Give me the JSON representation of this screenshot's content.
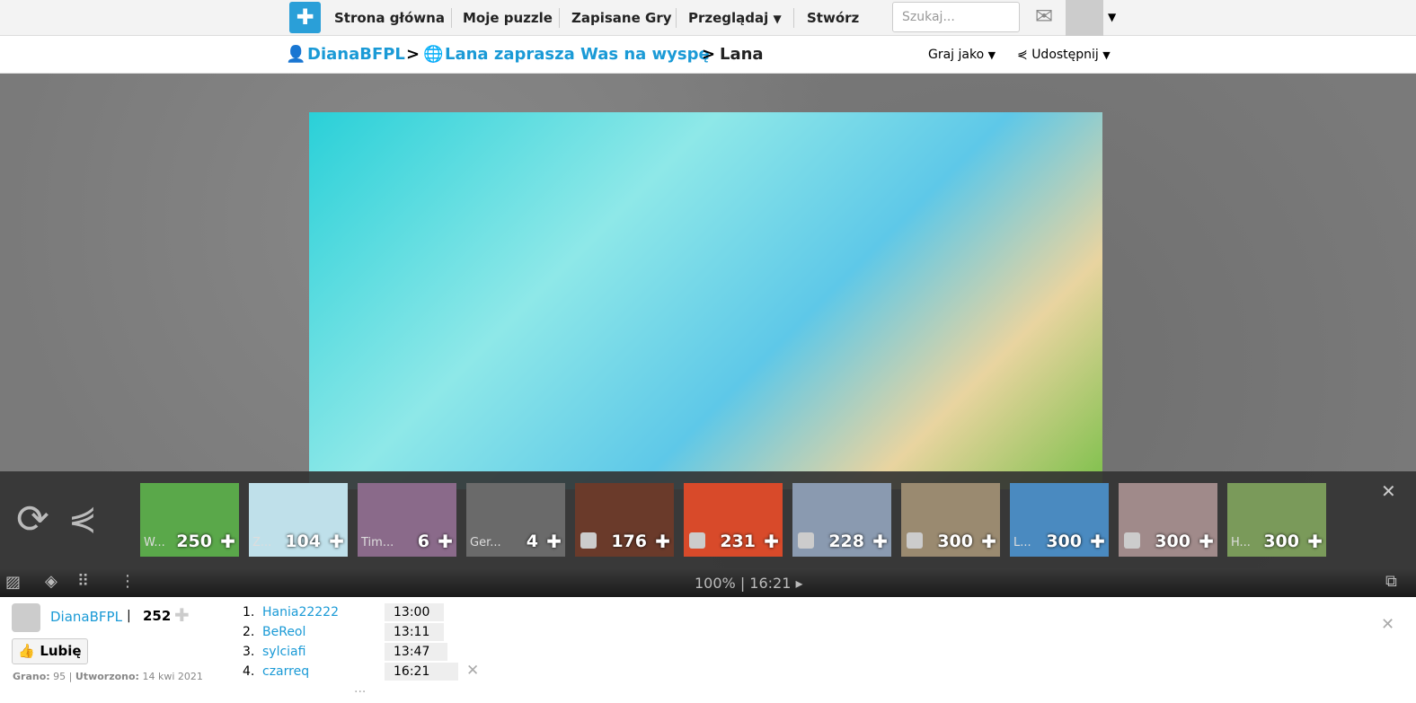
{
  "nav": {
    "items": [
      "Strona główna",
      "Moje puzzle",
      "Zapisane Gry",
      "Przeglądaj",
      "Stwórz"
    ],
    "search_placeholder": "Szukaj..."
  },
  "breadcrumb": {
    "user": "DianaBFPL",
    "album": "Lana zaprasza Was na wyspę",
    "current": "Lana",
    "sep": ">",
    "play_as": "Graj jako",
    "share": "Udostępnij"
  },
  "thumbnails": [
    {
      "label": "W...",
      "count": "250",
      "bg": "#5aa84a"
    },
    {
      "label": "Z...",
      "count": "104",
      "bg": "#bfe0ea"
    },
    {
      "label": "Tim...",
      "count": "6",
      "bg": "#8a6a8a"
    },
    {
      "label": "Ger...",
      "count": "4",
      "bg": "#6a6a6a"
    },
    {
      "label": "",
      "count": "176",
      "bg": "#6a3a2a",
      "avatar": true
    },
    {
      "label": "",
      "count": "231",
      "bg": "#d84a2a",
      "avatar": true
    },
    {
      "label": "",
      "count": "228",
      "bg": "#8a9ab0",
      "avatar": true
    },
    {
      "label": "",
      "count": "300",
      "bg": "#9a8a70",
      "avatar": true
    },
    {
      "label": "L...",
      "count": "300",
      "bg": "#4a8ac0"
    },
    {
      "label": "",
      "count": "300",
      "bg": "#a08a8a",
      "avatar": true
    },
    {
      "label": "H...",
      "count": "300",
      "bg": "#7a9a5a"
    }
  ],
  "toolbar": {
    "status": "100% | 16:21 ▸"
  },
  "info": {
    "user": "DianaBFPL",
    "pieces": "252",
    "like": "Lubię",
    "played_label": "Grano:",
    "played": "95",
    "created_label": "Utworzono:",
    "created": "14 kwi 2021"
  },
  "scores": [
    {
      "rank": "1.",
      "name": "Hania22222",
      "time": "13:00"
    },
    {
      "rank": "2.",
      "name": "BeReol",
      "time": "13:11"
    },
    {
      "rank": "3.",
      "name": "sylciafi",
      "time": "13:47"
    },
    {
      "rank": "4.",
      "name": "czarreq",
      "time": "16:21"
    }
  ],
  "more": "..."
}
